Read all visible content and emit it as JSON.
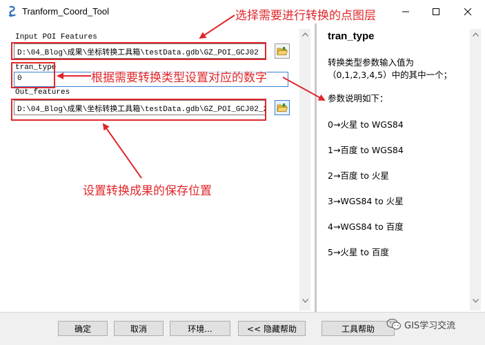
{
  "window": {
    "title": "Tranform_Coord_Tool"
  },
  "form": {
    "input_label": "Input POI Features",
    "input_value": "D:\\04_Blog\\成果\\坐标转换工具箱\\testData.gdb\\GZ_POI_GCJ02",
    "tran_label": "tran_type",
    "tran_value": "0",
    "out_label": "Out_features",
    "out_value": "D:\\04_Blog\\成果\\坐标转换工具箱\\testData.gdb\\GZ_POI_GCJ02_2"
  },
  "help": {
    "title": "tran_type",
    "desc_line1": "转换类型参数输入值为",
    "desc_line2": "（0,1,2,3,4,5）中的其中一个；",
    "param_header": "参数说明如下：",
    "options": [
      "0→火星  to WGS84",
      "1→百度  to WGS84",
      "2→百度  to 火星",
      "3→WGS84 to 火星",
      "4→WGS84 to 百度",
      "5→火星  to 百度"
    ]
  },
  "buttons": {
    "ok": "确定",
    "cancel": "取消",
    "env": "环境...",
    "hide_help": "<< 隐藏帮助",
    "tool_help": "工具帮助"
  },
  "annotations": {
    "select_layer": "选择需要进行转换的点图层",
    "set_number": "根据需要转换类型设置对应的数字",
    "save_location": "设置转换成果的保存位置"
  },
  "watermark": {
    "text": "GIS学习交流"
  },
  "colors": {
    "annotation_red": "#e0262a",
    "focus_blue": "#3c7fd6"
  }
}
